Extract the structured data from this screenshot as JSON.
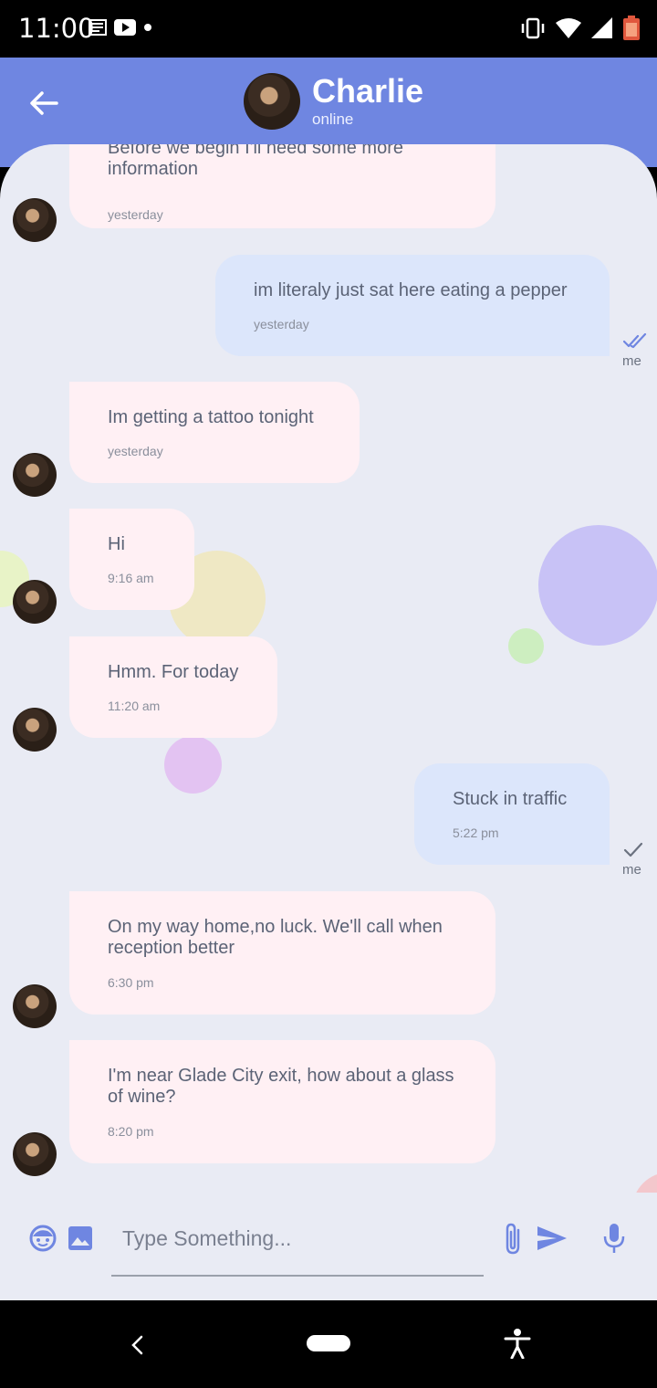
{
  "status_bar": {
    "time": "11:00"
  },
  "header": {
    "name": "Charlie",
    "status": "online"
  },
  "messages": [
    {
      "side": "left",
      "text": "Before we begin I'll need some more information",
      "time": "yesterday"
    },
    {
      "side": "right",
      "text": "im literaly just sat here eating a pepper",
      "time": "yesterday",
      "sender": "me",
      "read": true
    },
    {
      "side": "left",
      "text": "Im getting a tattoo tonight",
      "time": "yesterday"
    },
    {
      "side": "left",
      "text": "Hi",
      "time": "9:16 am"
    },
    {
      "side": "left",
      "text": "Hmm. For today",
      "time": "11:20 am"
    },
    {
      "side": "right",
      "text": "Stuck in traffic",
      "time": "5:22 pm",
      "sender": "me",
      "read": false
    },
    {
      "side": "left",
      "text": "On my way home,no luck. We'll call when reception better",
      "time": "6:30 pm"
    },
    {
      "side": "left",
      "text": "I'm near Glade City exit, how about a glass of wine?",
      "time": "8:20 pm"
    }
  ],
  "composer": {
    "placeholder": "Type Something..."
  },
  "colors": {
    "accent": "#6f86e1",
    "incoming_bubble": "#fff0f4",
    "outgoing_bubble": "#dce6fb",
    "background": "#e9ebf4"
  },
  "icons": [
    "back-arrow-icon",
    "emoji-icon",
    "image-icon",
    "attach-icon",
    "send-icon",
    "mic-icon",
    "double-check-icon",
    "check-icon"
  ]
}
